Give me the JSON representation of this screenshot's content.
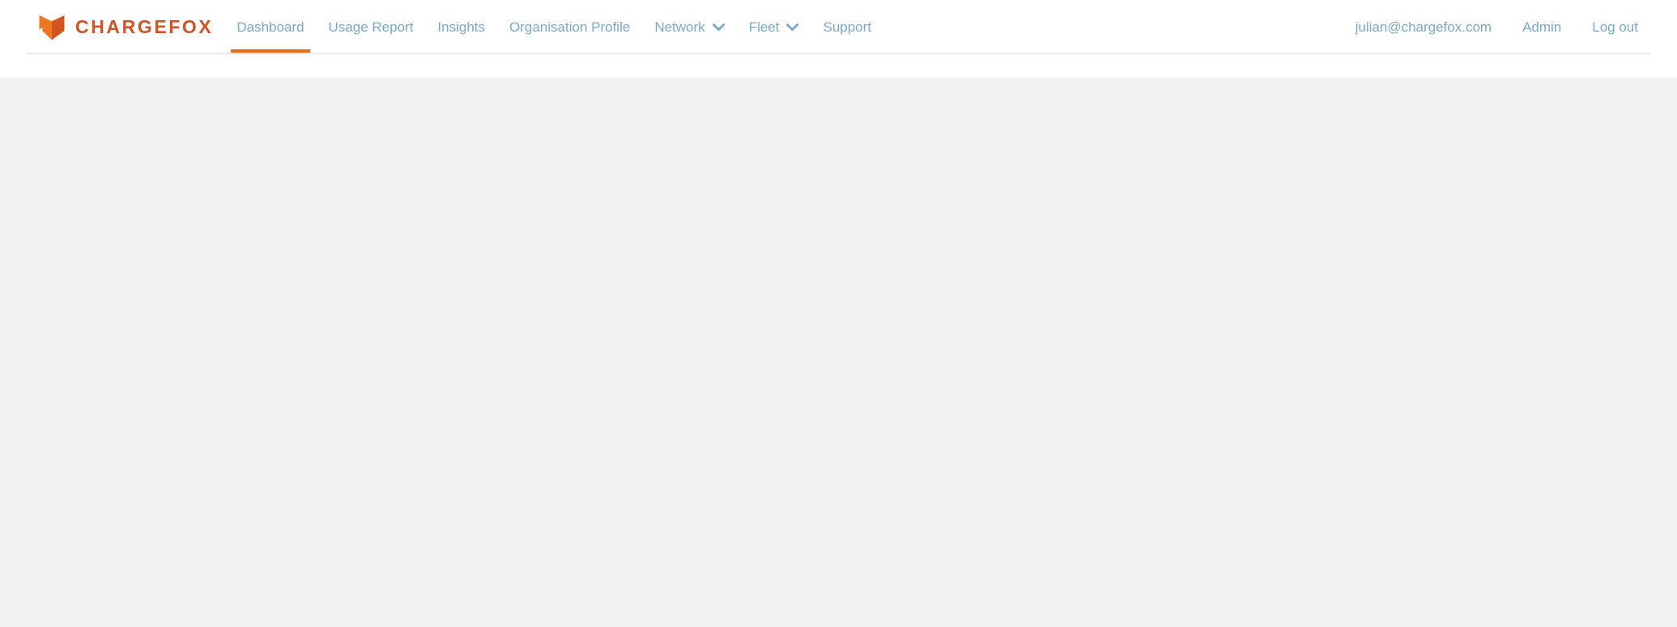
{
  "brand": {
    "wordmark": "CHARGEFOX",
    "logo_icon": "fox-head-icon",
    "color_primary": "#cd5427",
    "color_accent": "#ec6b11",
    "logo_light": "#ee7722",
    "logo_dark": "#d2541e"
  },
  "header": {
    "background": "#ffffff",
    "rule_color": "#e7e9ea",
    "link_color": "#7ba8c6",
    "active_indicator_color": "#ec6b11",
    "primary_nav": [
      {
        "label": "Dashboard",
        "active": true,
        "has_dropdown": false
      },
      {
        "label": "Usage Report",
        "active": false,
        "has_dropdown": false
      },
      {
        "label": "Insights",
        "active": false,
        "has_dropdown": false
      },
      {
        "label": "Organisation Profile",
        "active": false,
        "has_dropdown": false
      },
      {
        "label": "Network",
        "active": false,
        "has_dropdown": true,
        "dropdown_icon": "chevron-down-icon"
      },
      {
        "label": "Fleet",
        "active": false,
        "has_dropdown": true,
        "dropdown_icon": "chevron-down-icon"
      },
      {
        "label": "Support",
        "active": false,
        "has_dropdown": false
      }
    ],
    "secondary_nav": [
      {
        "label": "julian@chargefox.com",
        "name": "account-email"
      },
      {
        "label": "Admin",
        "name": "admin"
      },
      {
        "label": "Log out",
        "name": "log-out"
      }
    ]
  },
  "main": {
    "background": "#f0f0f0",
    "content": ""
  }
}
